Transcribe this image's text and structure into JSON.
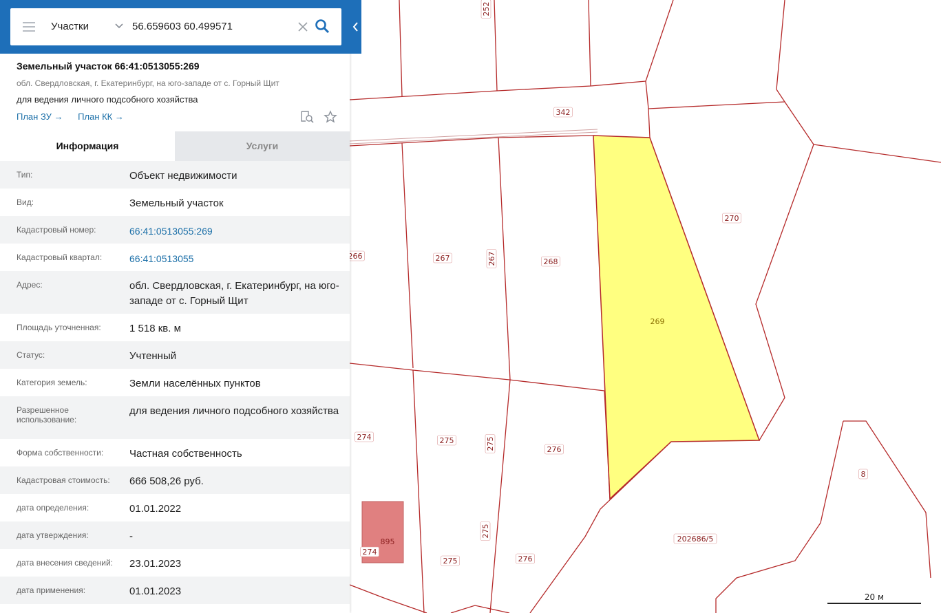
{
  "search": {
    "layer": "Участки",
    "query": "56.659603 60.499571"
  },
  "object": {
    "title": "Земельный участок 66:41:0513055:269",
    "address": "обл. Свердловская, г. Екатеринбург, на юго-западе от с. Горный Щит",
    "use": "для ведения личного подсобного хозяйства",
    "links": [
      "План ЗУ →",
      "План КК →"
    ]
  },
  "tabs": [
    "Информация",
    "Услуги"
  ],
  "rows": [
    {
      "label": "Тип:",
      "value": "Объект недвижимости"
    },
    {
      "label": "Вид:",
      "value": "Земельный участок"
    },
    {
      "label": "Кадастровый номер:",
      "value": "66:41:0513055:269"
    },
    {
      "label": "Кадастровый квартал:",
      "value": "66:41:0513055"
    },
    {
      "label": "Адрес:",
      "value": "обл. Свердловская, г. Екатеринбург, на юго-западе от с. Горный Щит"
    },
    {
      "label": "Площадь уточненная:",
      "value": "1 518 кв. м"
    },
    {
      "label": "Статус:",
      "value": "Учтенный"
    },
    {
      "label": "Категория земель:",
      "value": "Земли населённых пунктов"
    },
    {
      "label": "Разрешенное использование:",
      "value": "для ведения личного подсобного хозяйства"
    },
    {
      "label": "Форма собственности:",
      "value": "Частная собственность"
    },
    {
      "label": "Кадастровая стоимость:",
      "value": "666 508,26 руб."
    },
    {
      "label": "дата определения:",
      "value": "01.01.2022"
    },
    {
      "label": "дата утверждения:",
      "value": "-"
    },
    {
      "label": "дата внесения сведений:",
      "value": "23.01.2023"
    },
    {
      "label": "дата применения:",
      "value": "01.01.2023"
    }
  ],
  "map": {
    "parcel_labels": [
      "252",
      "342",
      "270",
      "266",
      "267",
      "267",
      "268",
      "269",
      "274",
      "275",
      "275",
      "276",
      "8",
      "275",
      "202686/5",
      "895",
      "274",
      "275",
      "276"
    ],
    "scale": "20 м",
    "colors": {
      "parcel_border": "#b52a2a",
      "selected_fill": "#ffff80",
      "building_fill": "#e08080",
      "topbar": "#1e6fb9"
    }
  }
}
